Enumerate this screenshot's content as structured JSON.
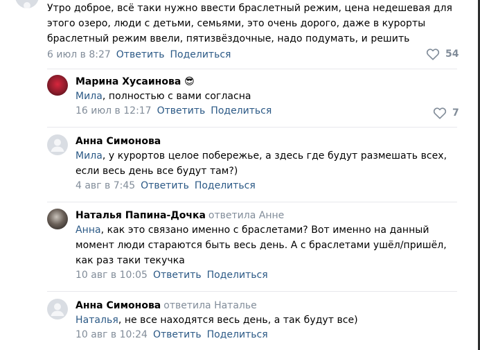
{
  "top_comment": {
    "text": "Утро доброе, всё таки нужно ввести браслетный режим, цена недешевая для этого озеро, люди с детьми, семьями, это очень дорого, даже в курорты браслетный режим ввели, пятизвёздочные, надо подумать, и решить",
    "date": "6 июл в 8:27",
    "reply_label": "Ответить",
    "share_label": "Поделиться",
    "likes": "54"
  },
  "replies": [
    {
      "author": "Марина Хусаинова",
      "emoji": "😎",
      "replied_to": "",
      "mention": "Мила",
      "text": ", полностью с вами согласна",
      "date": "16 июл в 12:17",
      "reply_label": "Ответить",
      "share_label": "Поделиться",
      "likes": "7"
    },
    {
      "author": "Анна Симонова",
      "replied_to": "",
      "mention": "Мила",
      "text": ", у курортов целое побережье, а здесь где будут размешать всех, если весь день все будут там?)",
      "date": "4 авг в 7:45",
      "reply_label": "Ответить",
      "share_label": "Поделиться"
    },
    {
      "author": "Наталья Папина-Дочка",
      "replied_to": "ответила Анне",
      "mention": "Анна",
      "text": ", как это связано именно с браслетами? Вот именно на данный момент люди стараются быть весь день. А с браслетами ушёл/пришёл, как раз таки текучка",
      "date": "10 авг в 10:05",
      "reply_label": "Ответить",
      "share_label": "Поделиться"
    },
    {
      "author": "Анна Симонова",
      "replied_to": "ответила Наталье",
      "mention": "Наталья",
      "text": ", не все находятся весь день, а так будут все)",
      "date": "10 авг в 10:24",
      "reply_label": "Ответить",
      "share_label": "Поделиться"
    }
  ],
  "icons": {
    "like": "heart-outline-icon",
    "default_avatar": "user-silhouette-icon"
  },
  "colors": {
    "link": "#2a5885",
    "muted": "#818c99",
    "divider": "#e7e8ec",
    "avatar_placeholder": "#d9dde3"
  }
}
